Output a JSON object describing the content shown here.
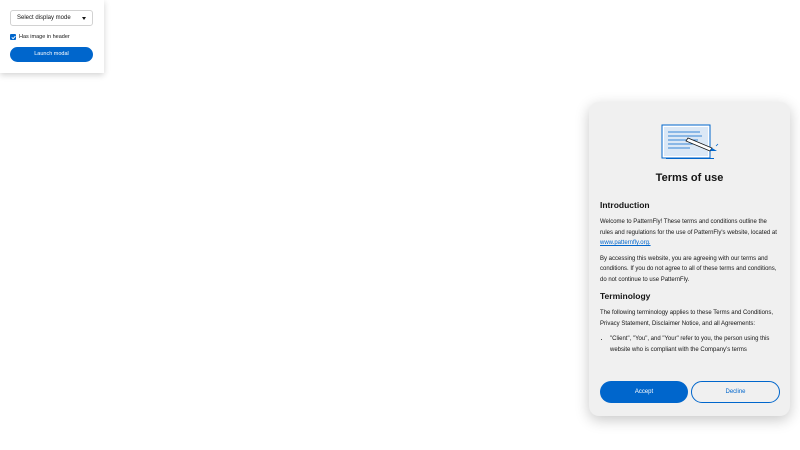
{
  "controls": {
    "display_mode_placeholder": "Select display mode",
    "has_image_label": "Has image in header",
    "has_image_checked": true,
    "launch_label": "Launch modal"
  },
  "modal": {
    "title": "Terms of use",
    "sections": [
      {
        "heading": "Introduction",
        "paragraphs": [
          {
            "before": "Welcome to PatternFly! These terms and conditions outline the rules and regulations for the use of PatternFly's website, located at ",
            "link": "www.patternfly.org.",
            "after": ""
          },
          {
            "text": "By accessing this website, you are agreeing with our terms and conditions. If you do not agree to all of these terms and conditions, do not continue to use PatternFly."
          }
        ]
      },
      {
        "heading": "Terminology",
        "paragraphs": [
          {
            "text": "The following terminology applies to these Terms and Conditions, Privacy Statement, Disclaimer Notice, and all Agreements:"
          }
        ],
        "list": [
          "\"Client\", \"You\", and \"Your\" refer to you, the person using this website who is compliant with the Company's terms"
        ]
      }
    ],
    "accept_label": "Accept",
    "decline_label": "Decline"
  },
  "colors": {
    "primary": "#0066cc",
    "modal_background": "#f0f0f0"
  },
  "icons": {
    "header_image": "document-with-pen-illustration",
    "select_caret": "caret-down-icon",
    "checkbox_mark": "check-icon"
  }
}
